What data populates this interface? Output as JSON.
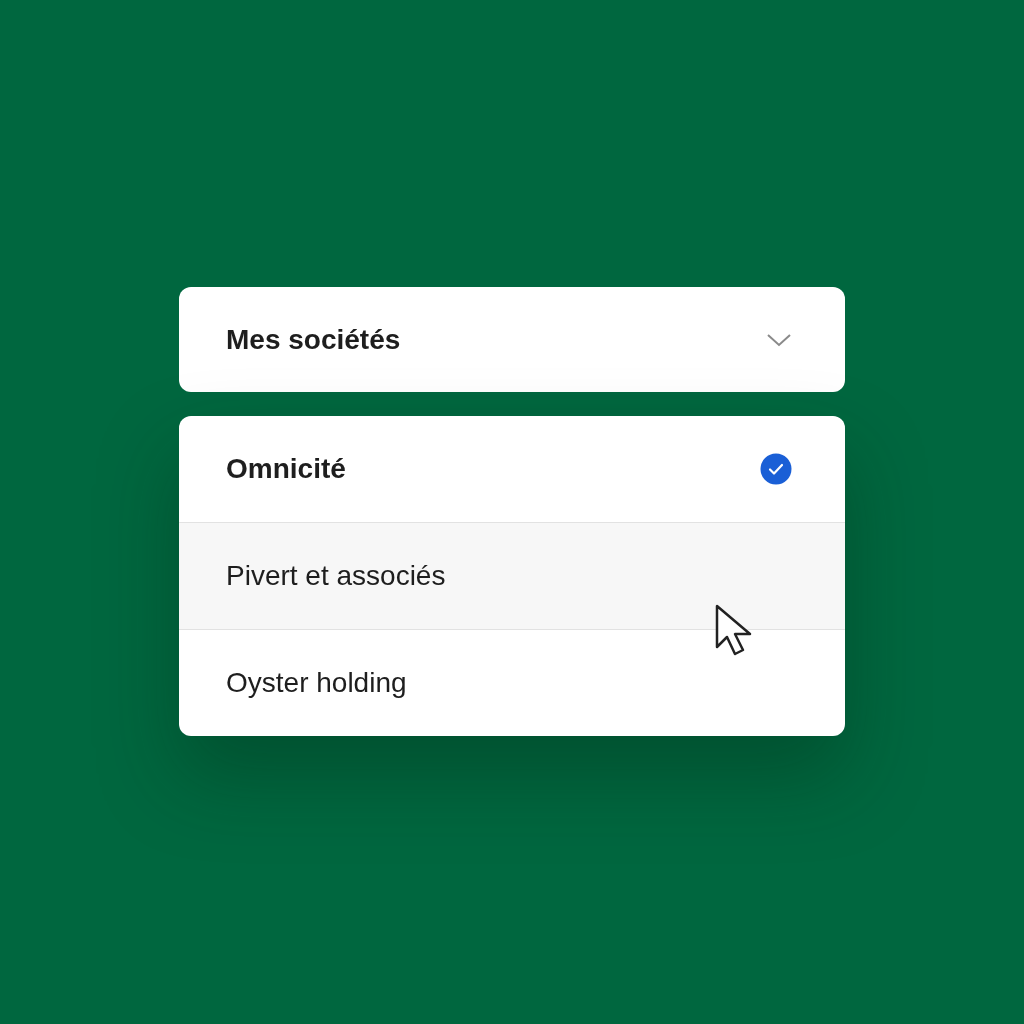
{
  "dropdown": {
    "label": "Mes sociétés",
    "expanded": true
  },
  "options": [
    {
      "label": "Omnicité",
      "selected": true,
      "hovered": false
    },
    {
      "label": "Pivert et associés",
      "selected": false,
      "hovered": true
    },
    {
      "label": "Oyster holding",
      "selected": false,
      "hovered": false
    }
  ]
}
